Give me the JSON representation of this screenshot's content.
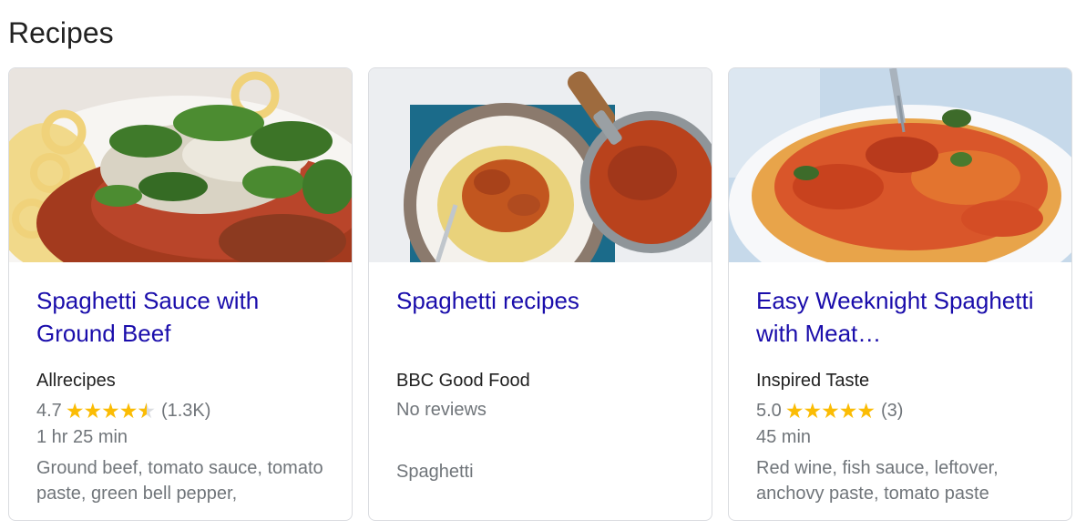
{
  "section": {
    "title": "Recipes"
  },
  "cards": [
    {
      "title": "Spaghetti Sauce with Ground Beef",
      "source": "Allrecipes",
      "rating": "4.7",
      "rating_value": 4.7,
      "review_count": "(1.3K)",
      "time": "1 hr 25 min",
      "ingredients": "Ground beef, tomato sauce, tomato paste, green bell pepper,"
    },
    {
      "title": "Spaghetti recipes",
      "source": "BBC Good Food",
      "no_reviews": "No reviews",
      "ingredients": "Spaghetti"
    },
    {
      "title": "Easy Weeknight Spaghetti with Meat…",
      "source": "Inspired Taste",
      "rating": "5.0",
      "rating_value": 5.0,
      "review_count": "(3)",
      "time": "45 min",
      "ingredients": "Red wine, fish sauce, leftover, anchovy paste, tomato paste"
    }
  ],
  "colors": {
    "link": "#1a0dab",
    "star": "#fbbc04",
    "muted": "#70757a"
  }
}
